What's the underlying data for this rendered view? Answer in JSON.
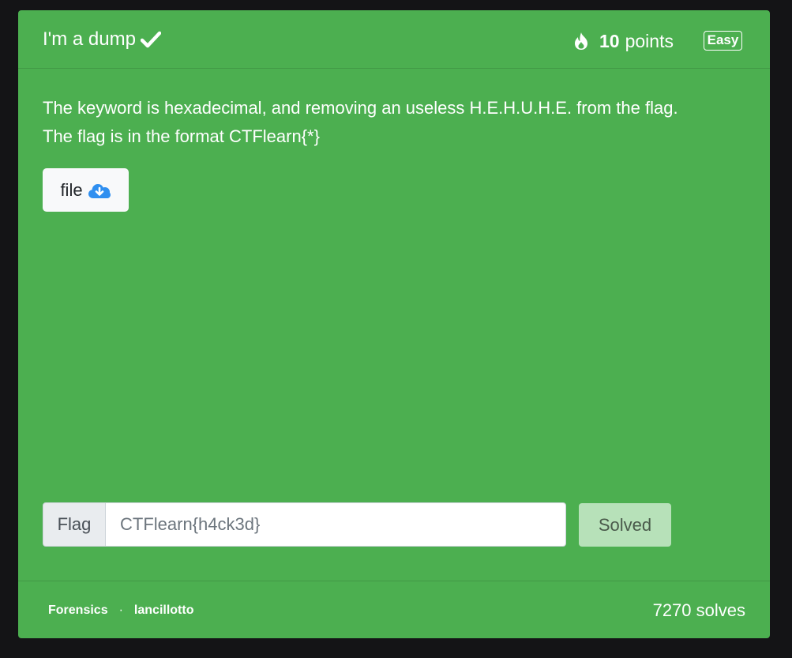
{
  "challenge": {
    "title": "I'm a dump",
    "points_value": "10",
    "points_label": "points",
    "difficulty": "Easy",
    "description_lines": [
      "The keyword is hexadecimal, and removing an useless H.E.H.U.H.E. from the flag.",
      "The flag is in the format CTFlearn{*}"
    ],
    "file_label": "file",
    "flag_label": "Flag",
    "flag_value": "CTFlearn{h4ck3d}",
    "submit_label": "Solved",
    "category": "Forensics",
    "separator": "·",
    "author": "lancillotto",
    "solves": "7270 solves"
  },
  "colors": {
    "card_bg": "#4caf50",
    "page_bg": "#141416",
    "download_icon": "#2f8ff0"
  },
  "icons": {
    "title_status": "check-icon",
    "points": "fire-icon",
    "file": "cloud-download-icon"
  }
}
